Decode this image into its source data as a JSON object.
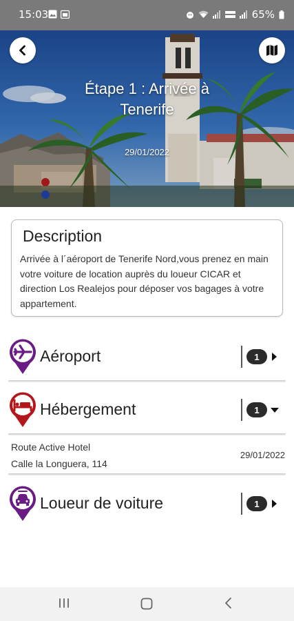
{
  "status_bar": {
    "time": "15:03",
    "battery": "65%",
    "left_icons": [
      "image-icon",
      "calendar-icon"
    ],
    "right_icons": [
      "alarm-icon",
      "wifi-icon",
      "signal-icon",
      "volte-icon",
      "signal-icon",
      "battery-icon"
    ]
  },
  "hero": {
    "title": "Étape  1 : Arrivée à Tenerife",
    "date": "29/01/2022",
    "back_icon": "chevron-left-icon",
    "map_icon": "map-icon"
  },
  "description": {
    "title": "Description",
    "text": "Arrivée à l´aéroport de Tenerife Nord,vous prenez en main votre voiture de location auprès du loueur CICAR et direction Los Realejos pour déposer vos bagages à votre appartement."
  },
  "categories": [
    {
      "label": "Aéroport",
      "count": "1",
      "icon": "airplane-icon",
      "pin_color": "#6a1b84",
      "expanded": false
    },
    {
      "label": "Hébergement",
      "count": "1",
      "icon": "bed-icon",
      "pin_color": "#b3171c",
      "expanded": true
    },
    {
      "label": "Loueur de voiture",
      "count": "1",
      "icon": "car-icon",
      "pin_color": "#6a1b84",
      "expanded": false
    }
  ],
  "hotel": {
    "name": "Route Active Hotel",
    "address": "Calle la Longuera, 114",
    "date": "29/01/2022"
  },
  "nav_bar": {
    "icons": [
      "recent-apps-icon",
      "home-icon",
      "back-icon"
    ]
  }
}
